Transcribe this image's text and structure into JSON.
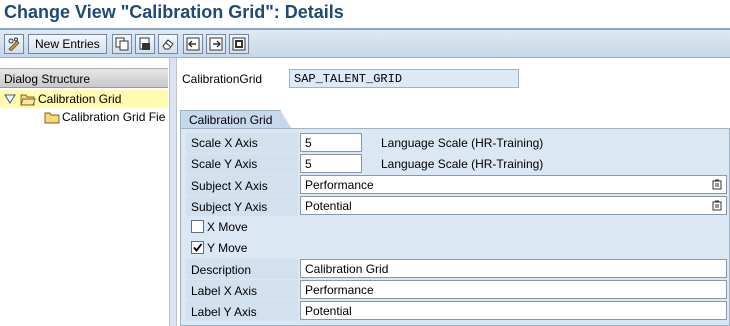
{
  "title": "Change View \"Calibration Grid\": Details",
  "toolbar": {
    "new_entries_label": "New Entries"
  },
  "left_panel": {
    "header": "Dialog Structure",
    "items": [
      {
        "label": "Calibration Grid",
        "selected": true,
        "expanded": true
      },
      {
        "label": "Calibration Grid Fie",
        "selected": false
      }
    ]
  },
  "content": {
    "calibration_grid_label": "CalibrationGrid",
    "calibration_grid_value": "SAP_TALENT_GRID",
    "group_title": "Calibration Grid",
    "fields": {
      "scale_x_label": "Scale X Axis",
      "scale_x_value": "5",
      "scale_x_desc": "Language Scale (HR-Training)",
      "scale_y_label": "Scale Y Axis",
      "scale_y_value": "5",
      "scale_y_desc": "Language Scale (HR-Training)",
      "subject_x_label": "Subject X Axis",
      "subject_x_value": "Performance",
      "subject_y_label": "Subject Y Axis",
      "subject_y_value": "Potential",
      "x_move_label": "X Move",
      "x_move_checked": false,
      "y_move_label": "Y Move",
      "y_move_checked": true,
      "description_label": "Description",
      "description_value": "Calibration Grid",
      "label_x_label": "Label X Axis",
      "label_x_value": "Performance",
      "label_y_label": "Label Y Axis",
      "label_y_value": "Potential"
    }
  },
  "colors": {
    "title": "#1e4a7a",
    "group_bg": "#dbe7f3",
    "selected_row": "#fffbb0"
  }
}
